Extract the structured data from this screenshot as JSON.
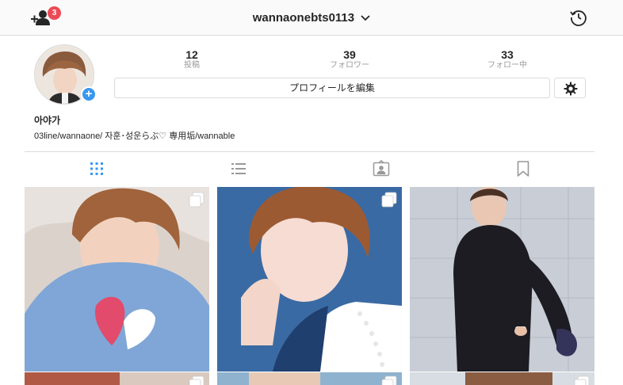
{
  "topbar": {
    "username": "wannaonebts0113",
    "notification_count": "3"
  },
  "profile": {
    "stats": [
      {
        "number": "12",
        "label": "投稿"
      },
      {
        "number": "39",
        "label": "フォロワー"
      },
      {
        "number": "33",
        "label": "フォロー中"
      }
    ],
    "edit_button_label": "プロフィールを編集",
    "display_name": "아야가",
    "bio": "03line/wannaone/ 자훈･성운らぶ♡ 専用垢/wannable",
    "avatar_plus": "+"
  },
  "tabs": [
    {
      "name": "grid",
      "icon": "grid-icon",
      "active": true
    },
    {
      "name": "list",
      "icon": "list-icon",
      "active": false
    },
    {
      "name": "tagged",
      "icon": "tagged-icon",
      "active": false
    },
    {
      "name": "saved",
      "icon": "bookmark-icon",
      "active": false
    }
  ],
  "colors": {
    "badge": "#ed4956",
    "accent_blue": "#3897f0",
    "border": "#dbdbdb",
    "active_tab": "#3897f0",
    "inactive_tab": "#999999"
  }
}
